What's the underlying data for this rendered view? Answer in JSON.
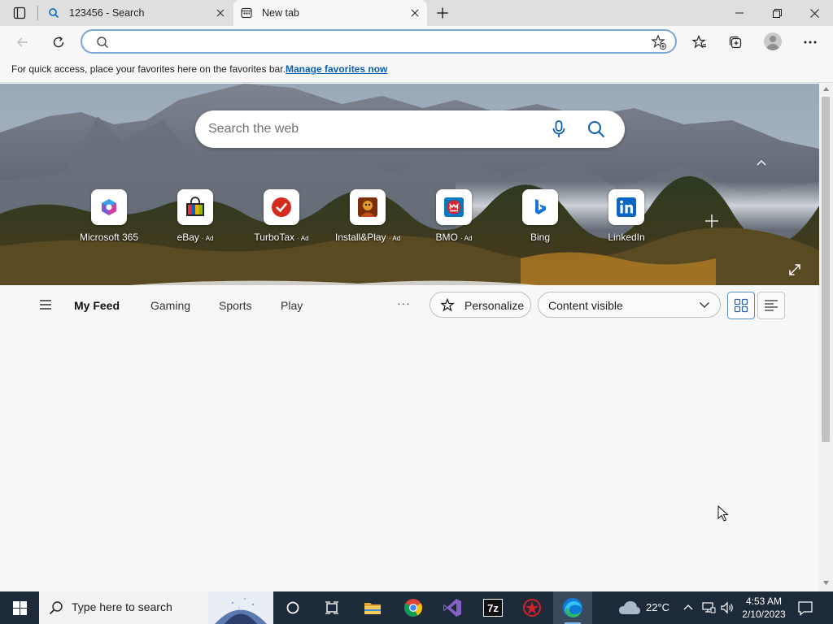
{
  "browser": {
    "tabs": [
      {
        "title": "123456 - Search",
        "icon": "search-icon",
        "active": false
      },
      {
        "title": "New tab",
        "icon": "newtab-page-icon",
        "active": true
      }
    ],
    "address_value": "",
    "favorites_bar": {
      "message": "For quick access, place your favorites here on the favorites bar.",
      "link": "Manage favorites now"
    }
  },
  "newtab": {
    "search_placeholder": "Search the web",
    "quick_links": [
      {
        "label": "Microsoft 365",
        "ad": "",
        "icon": "microsoft365-icon"
      },
      {
        "label": "eBay",
        "ad": "· Ad",
        "icon": "ebay-icon"
      },
      {
        "label": "TurboTax",
        "ad": "· Ad",
        "icon": "turbotax-icon"
      },
      {
        "label": "Install&Play",
        "ad": "· Ad",
        "icon": "installplay-icon"
      },
      {
        "label": "BMO",
        "ad": "· Ad",
        "icon": "bmo-icon"
      },
      {
        "label": "Bing",
        "ad": "",
        "icon": "bing-icon"
      },
      {
        "label": "LinkedIn",
        "ad": "",
        "icon": "linkedin-icon"
      }
    ],
    "feed": {
      "tabs": [
        "My Feed",
        "Gaming",
        "Sports",
        "Play"
      ],
      "active_tab": "My Feed",
      "more": "···",
      "personalize": "Personalize",
      "content_option": "Content visible"
    }
  },
  "taskbar": {
    "search_placeholder": "Type here to search",
    "apps": [
      "cortana-icon",
      "task-view-icon",
      "file-explorer-icon",
      "chrome-icon",
      "visual-studio-icon",
      "7zip-icon",
      "app-red-icon",
      "edge-icon"
    ],
    "weather_temp": "22°C",
    "time": "4:53 AM",
    "date": "2/10/2023"
  },
  "colors": {
    "accent": "#0a5fb4",
    "taskbar": "#1c2a3a",
    "address_border": "#7aa7d6"
  }
}
